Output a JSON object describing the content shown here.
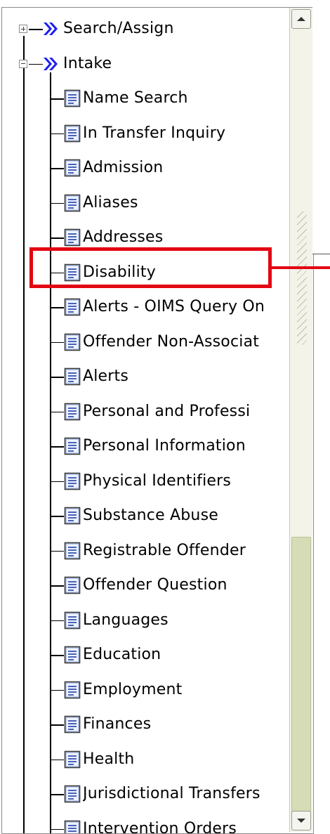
{
  "tree": {
    "top_nodes": [
      {
        "label": "Search/Assign",
        "expanded": false
      },
      {
        "label": "Intake",
        "expanded": true
      }
    ],
    "intake_children": [
      "Name Search",
      "In Transfer Inquiry",
      "Admission",
      "Aliases",
      "Addresses",
      "Disability",
      "Alerts - OIMS Query On",
      "Offender Non-Associat",
      "Alerts",
      "Personal and Professi",
      "Personal Information",
      "Physical Identifiers",
      "Substance Abuse",
      "Registrable Offender",
      "Offender Question",
      "Languages",
      "Education",
      "Employment",
      "Finances",
      "Health",
      "Jurisdictional Transfers",
      "Intervention Orders"
    ],
    "highlighted_item": "Disability"
  },
  "colors": {
    "highlight": "#e30613",
    "arrow_icon": "#1c1cf0",
    "scroll_thumb": "#d6dcb6"
  },
  "icons": {
    "expander_collapsed": "plus-box-icon",
    "expander_expanded": "minus-box-icon",
    "branch": "double-chevron-right-icon",
    "leaf": "document-icon",
    "scroll_up": "arrow-up-icon",
    "scroll_down": "arrow-down-icon"
  }
}
